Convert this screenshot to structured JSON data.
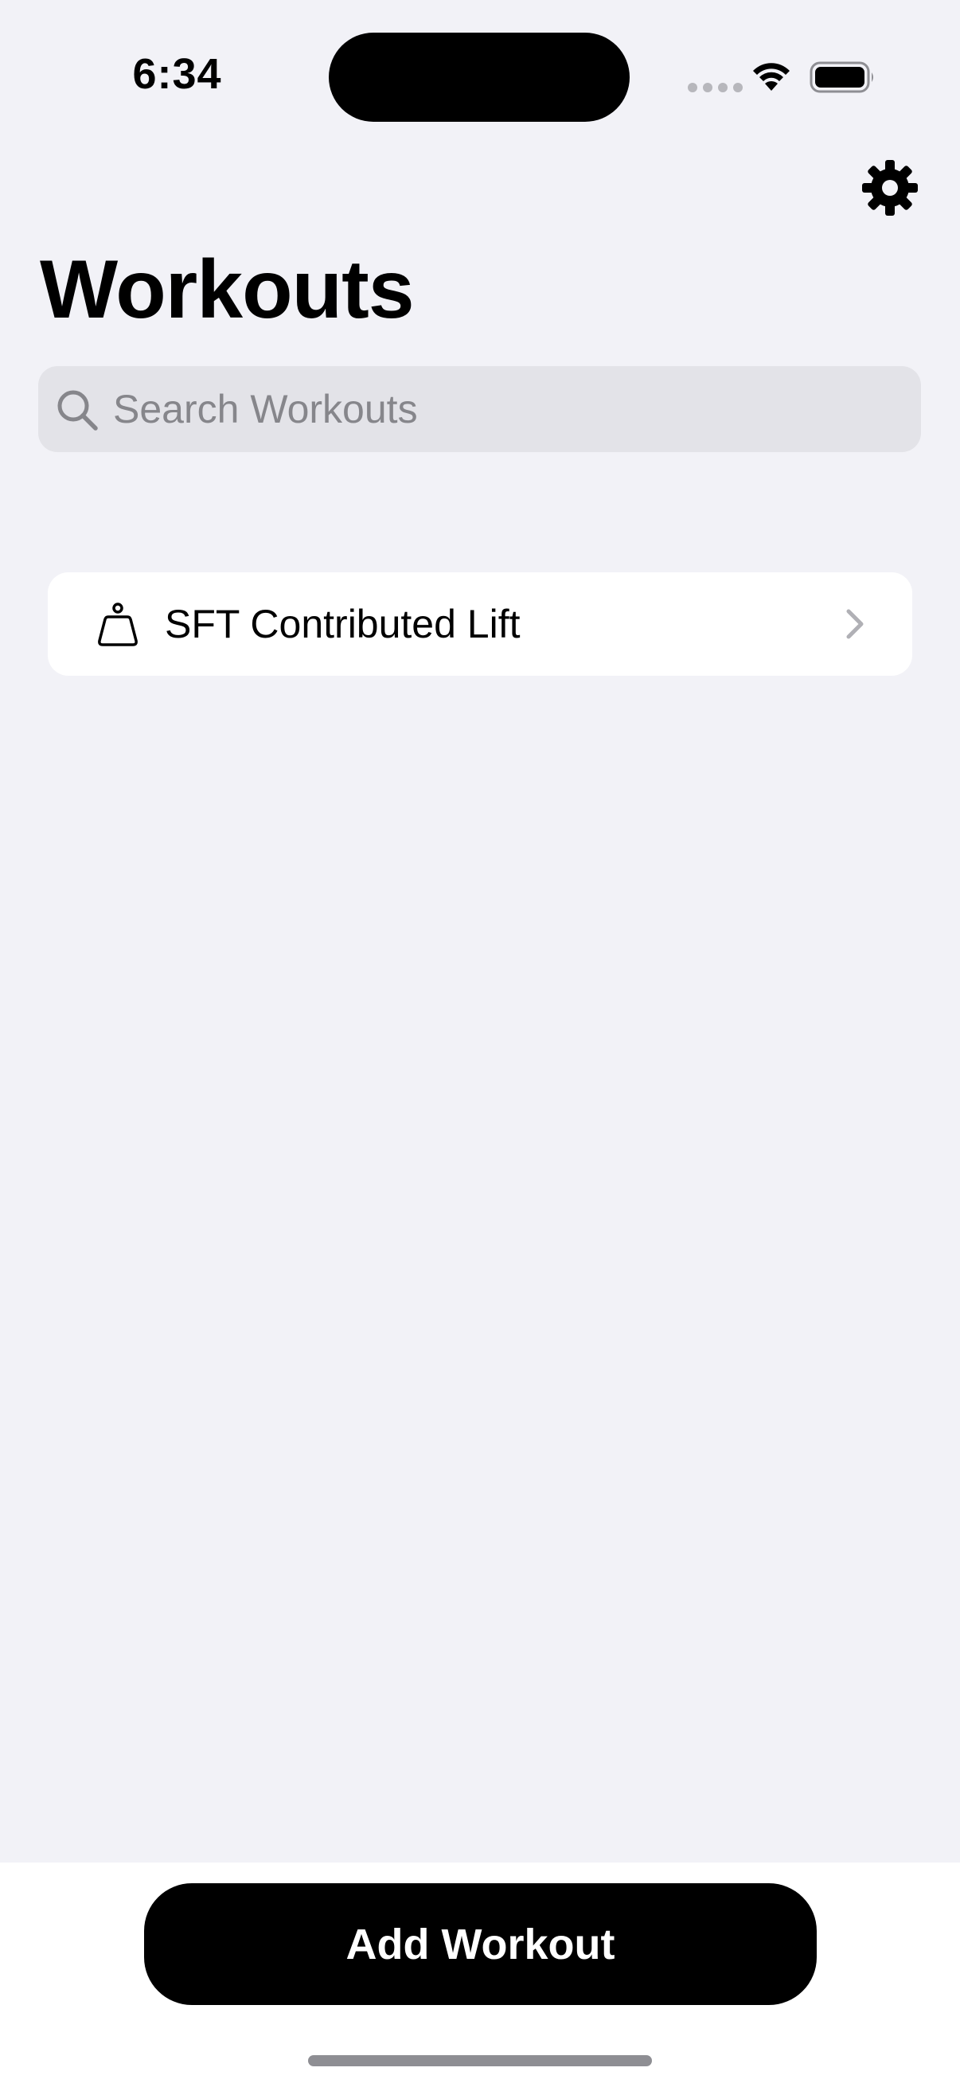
{
  "status_bar": {
    "time": "6:34"
  },
  "header": {
    "title": "Workouts",
    "settings_icon": "gear-icon"
  },
  "search": {
    "placeholder": "Search Workouts",
    "value": ""
  },
  "workouts": [
    {
      "name": "SFT Contributed Lift",
      "icon": "kettlebell-icon"
    }
  ],
  "footer": {
    "add_button_label": "Add Workout"
  },
  "colors": {
    "background": "#f2f2f7",
    "card": "#ffffff",
    "search_field": "#e3e3e8",
    "placeholder": "#86868b",
    "button": "#000000"
  }
}
